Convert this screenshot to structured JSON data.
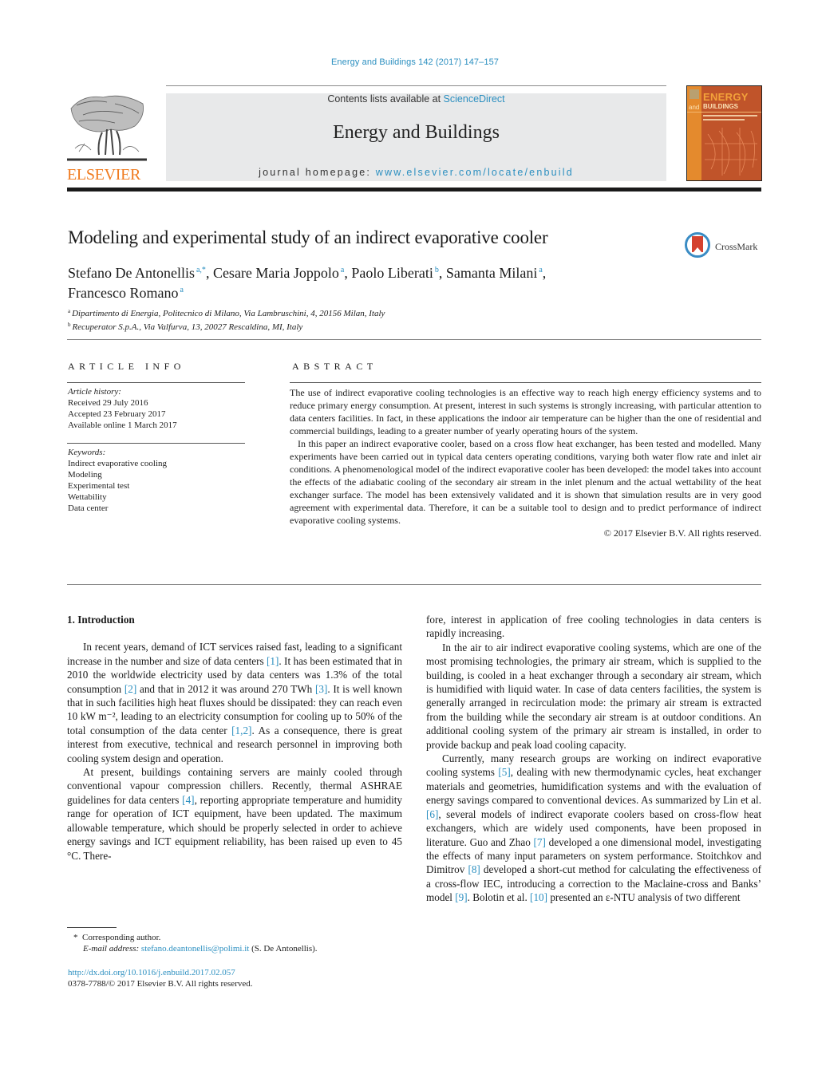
{
  "header": {
    "journal_ref": "Energy and Buildings 142 (2017) 147–157",
    "contents_prefix": "Contents lists available at ",
    "contents_link": "ScienceDirect",
    "journal_name": "Energy and Buildings",
    "homepage_prefix": "journal homepage: ",
    "homepage_link": "www.elsevier.com/locate/enbuild",
    "publisher_logo_text": "ELSEVIER",
    "cover": {
      "energy": "ENERGY",
      "and": "and",
      "buildings": "BUILDINGS"
    },
    "colors": {
      "link": "#2b8fc0",
      "elsevier_orange": "#f07b1f",
      "panel_gray": "#e8e9ea",
      "cover_red": "#c0542a"
    }
  },
  "article": {
    "title": "Modeling and experimental study of an indirect evaporative cooler",
    "crossmark_label": "CrossMark",
    "authors": [
      {
        "name": "Stefano De Antonellis",
        "sup": "a,*",
        "sep": ", "
      },
      {
        "name": "Cesare Maria Joppolo",
        "sup": "a",
        "sep": ", "
      },
      {
        "name": "Paolo Liberati",
        "sup": "b",
        "sep": ", "
      },
      {
        "name": "Samanta Milani",
        "sup": "a",
        "sep": ","
      },
      {
        "name": "Francesco Romano",
        "sup": "a",
        "sep": ""
      }
    ],
    "affiliations": [
      {
        "sup": "a",
        "text": "Dipartimento di Energia, Politecnico di Milano, Via Lambruschini, 4, 20156 Milan, Italy"
      },
      {
        "sup": "b",
        "text": "Recuperator S.p.A., Via Valfurva, 13, 20027 Rescaldina, MI, Italy"
      }
    ]
  },
  "article_info": {
    "heading": "ARTICLE INFO",
    "history_label": "Article history:",
    "history": [
      "Received 29 July 2016",
      "Accepted 23 February 2017",
      "Available online 1 March 2017"
    ],
    "keywords_label": "Keywords:",
    "keywords": [
      "Indirect evaporative cooling",
      "Modeling",
      "Experimental test",
      "Wettability",
      "Data center"
    ]
  },
  "abstract": {
    "heading": "ABSTRACT",
    "paragraphs": [
      "The use of indirect evaporative cooling technologies is an effective way to reach high energy efficiency systems and to reduce primary energy consumption. At present, interest in such systems is strongly increasing, with particular attention to data centers facilities. In fact, in these applications the indoor air temperature can be higher than the one of residential and commercial buildings, leading to a greater number of yearly operating hours of the system.",
      "In this paper an indirect evaporative cooler, based on a cross flow heat exchanger, has been tested and modelled. Many experiments have been carried out in typical data centers operating conditions, varying both water flow rate and inlet air conditions. A phenomenological model of the indirect evaporative cooler has been developed: the model takes into account the effects of the adiabatic cooling of the secondary air stream in the inlet plenum and the actual wettability of the heat exchanger surface. The model has been extensively validated and it is shown that simulation results are in very good agreement with experimental data. Therefore, it can be a suitable tool to design and to predict performance of indirect evaporative cooling systems."
    ],
    "copyright": "© 2017 Elsevier B.V. All rights reserved."
  },
  "body": {
    "section_heading": "1.  Introduction",
    "left_paragraphs": [
      [
        {
          "t": "In recent years, demand of ICT services raised fast, leading to a significant increase in the number and size of data centers "
        },
        {
          "ref": "[1]"
        },
        {
          "t": ". It has been estimated that in 2010 the worldwide electricity used by data centers was 1.3% of the total consumption "
        },
        {
          "ref": "[2]"
        },
        {
          "t": " and that in 2012 it was around 270 TWh "
        },
        {
          "ref": "[3]"
        },
        {
          "t": ". It is well known that in such facilities high heat fluxes should be dissipated: they can reach even 10 kW m⁻², leading to an electricity consumption for cooling up to 50% of the total consumption of the data center "
        },
        {
          "ref": "[1,2]"
        },
        {
          "t": ". As a consequence, there is great interest from executive, technical and research personnel in improving both cooling system design and operation."
        }
      ],
      [
        {
          "t": "At present, buildings containing servers are mainly cooled through conventional vapour compression chillers. Recently, thermal ASHRAE guidelines for data centers "
        },
        {
          "ref": "[4]"
        },
        {
          "t": ", reporting appropriate temperature and humidity range for operation of ICT equipment, have been updated. The maximum allowable temperature, which should be properly selected in order to achieve energy savings and ICT equipment reliability, has been raised up even to 45 °C. There-"
        }
      ]
    ],
    "right_paragraphs": [
      [
        {
          "t": "fore, interest in application of free cooling technologies in data centers is rapidly increasing."
        }
      ],
      [
        {
          "t": "In the air to air indirect evaporative cooling systems, which are one of the most promising technologies, the primary air stream, which is supplied to the building, is cooled in a heat exchanger through a secondary air stream, which is humidified with liquid water. In case of data centers facilities, the system is generally arranged in recirculation mode: the primary air stream is extracted from the building while the secondary air stream is at outdoor conditions. An additional cooling system of the primary air stream is installed, in order to provide backup and peak load cooling capacity."
        }
      ],
      [
        {
          "t": "Currently, many research groups are working on indirect evaporative cooling systems "
        },
        {
          "ref": "[5]"
        },
        {
          "t": ", dealing with new thermodynamic cycles, heat exchanger materials and geometries, humidification systems and with the evaluation of energy savings compared to conventional devices. As summarized by Lin et al. "
        },
        {
          "ref": "[6]"
        },
        {
          "t": ", several models of indirect evaporate coolers based on cross-flow heat exchangers, which are widely used components, have been proposed in literature. Guo and Zhao "
        },
        {
          "ref": "[7]"
        },
        {
          "t": " developed a one dimensional model, investigating the effects of many input parameters on system performance. Stoitchkov and Dimitrov "
        },
        {
          "ref": "[8]"
        },
        {
          "t": " developed a short-cut method for calculating the effectiveness of a cross-flow IEC, introducing a correction to the Maclaine-cross and Banks’ model "
        },
        {
          "ref": "[9]"
        },
        {
          "t": ". Bolotin et al. "
        },
        {
          "ref": "[10]"
        },
        {
          "t": " presented an ε-NTU analysis of two different"
        }
      ]
    ]
  },
  "footnotes": {
    "corresponding_mark": "*",
    "corresponding_text": "Corresponding author.",
    "email_label": "E-mail address:",
    "email": "stefano.deantonellis@polimi.it",
    "email_suffix": " (S. De Antonellis).",
    "doi": "http://dx.doi.org/10.1016/j.enbuild.2017.02.057",
    "issn_line": "0378-7788/© 2017 Elsevier B.V. All rights reserved."
  }
}
